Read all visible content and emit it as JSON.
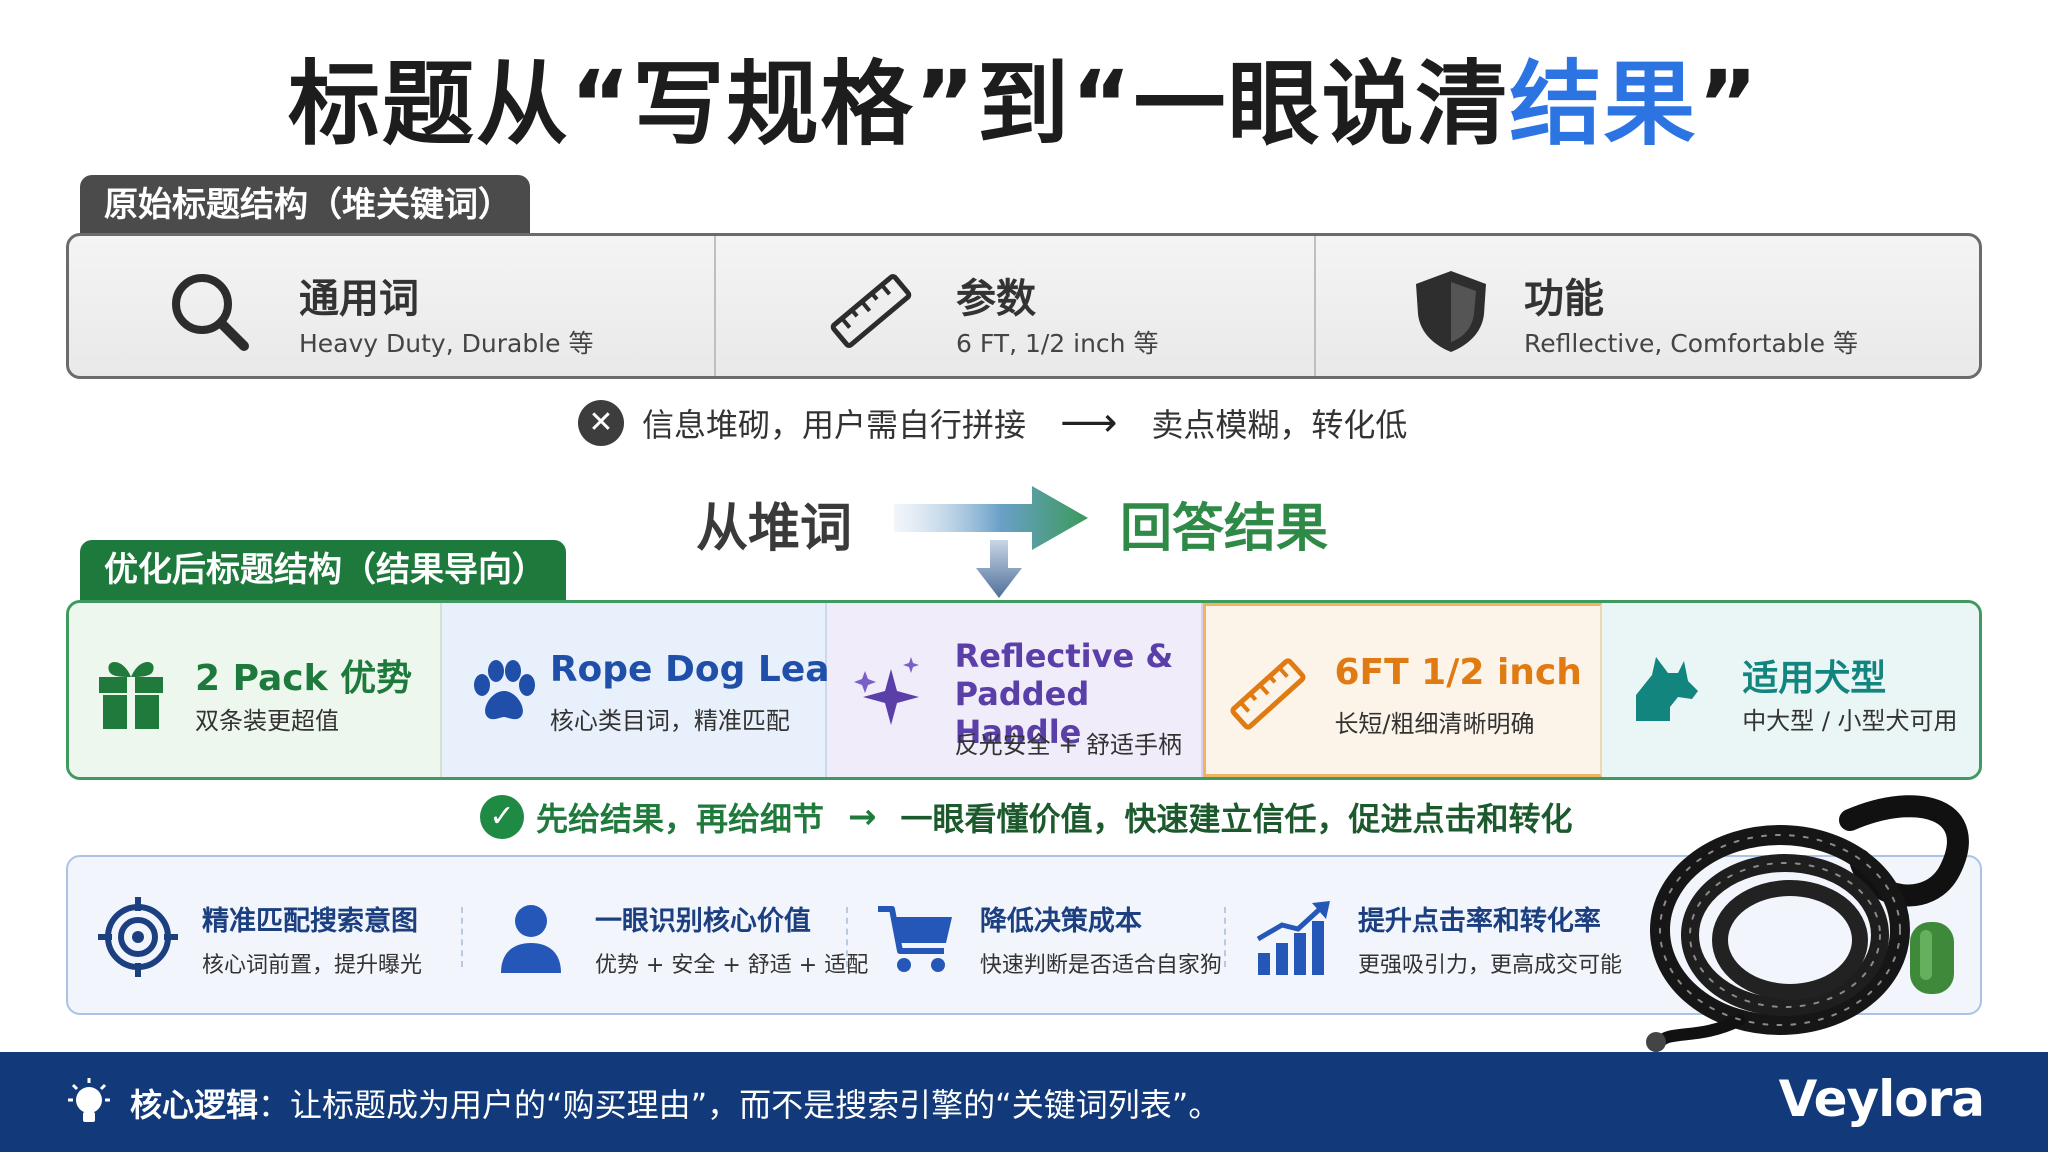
{
  "title": {
    "prefix": "标题从“写规格”到“一眼说清",
    "accent": "结果",
    "suffix": "”"
  },
  "original": {
    "tag": "原始标题结构（堆关键词）",
    "cells": [
      {
        "icon": "search-icon",
        "heading": "通用词",
        "sub": "Heavy Duty, Durable 等"
      },
      {
        "icon": "ruler-icon",
        "heading": "参数",
        "sub": "6 FT, 1/2 inch 等"
      },
      {
        "icon": "shield-icon",
        "heading": "功能",
        "sub": "Refllective, Comfortable 等"
      }
    ],
    "warning": {
      "left": "信息堆砌，用户需自行拼接",
      "arrow": "⟶",
      "right": "卖点模糊，转化低"
    }
  },
  "transition": {
    "from": "从堆词",
    "to": "回答结果"
  },
  "optimized": {
    "tag": "优化后标题结构（结果导向）",
    "cells": [
      {
        "icon": "gift-icon",
        "heading": "2 Pack 优势",
        "sub": "双条装更超值"
      },
      {
        "icon": "paw-icon",
        "heading": "Rope Dog Leash",
        "sub": "核心类目词，精准匹配"
      },
      {
        "icon": "sparkle-icon",
        "heading": "Reflective & Padded Handle",
        "sub": "反光安全 + 舒适手柄"
      },
      {
        "icon": "ruler-icon",
        "heading": "6FT 1/2 inch",
        "sub": "长短/粗细清晰明确"
      },
      {
        "icon": "dog-head-icon",
        "heading": "适用犬型",
        "sub": "中大型 / 小型犬可用"
      }
    ],
    "summary": {
      "left": "先给结果，再给细节",
      "arrow": "→",
      "right": "一眼看懂价值，快速建立信任，促进点击和转化"
    }
  },
  "benefits": [
    {
      "icon": "target-icon",
      "heading": "精准匹配搜索意图",
      "sub": "核心词前置，提升曝光"
    },
    {
      "icon": "user-icon",
      "heading": "一眼识别核心价值",
      "sub": "优势 + 安全 + 舒适 + 适配"
    },
    {
      "icon": "cart-icon",
      "heading": "降低决策成本",
      "sub": "快速判断是否适合自家狗"
    },
    {
      "icon": "growth-chart-icon",
      "heading": "提升点击率和转化率",
      "sub": "更强吸引力，更高成交可能"
    }
  ],
  "footer": {
    "label": "核心逻辑",
    "text": "：让标题成为用户的“购买理由”，而不是搜索引擎的“关键词列表”。",
    "brand": "Veylora"
  },
  "colors": {
    "accent_blue": "#2d74e3",
    "green": "#1e7a3c",
    "footer_bg": "#123a7a"
  }
}
